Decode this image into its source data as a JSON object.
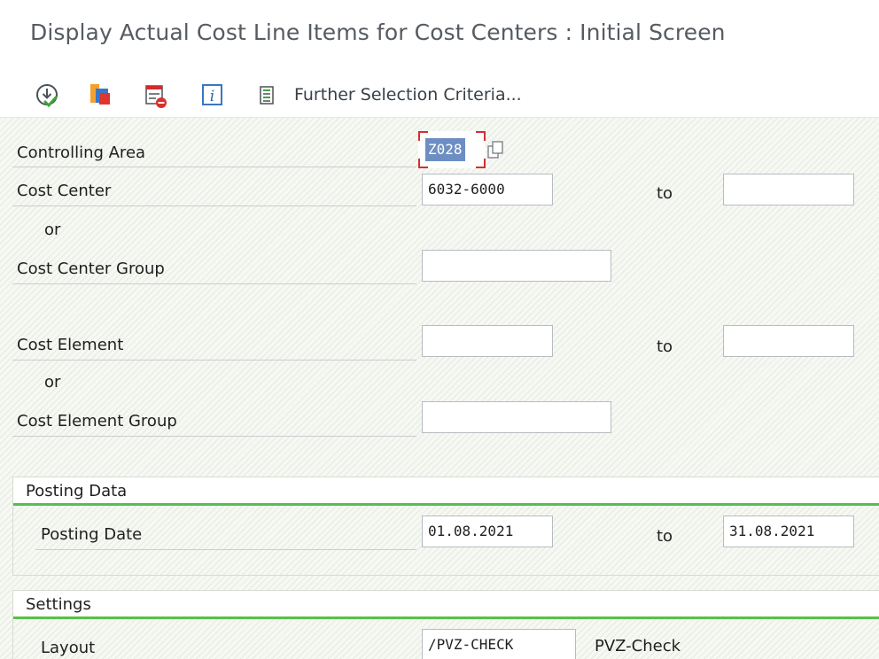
{
  "window": {
    "title": "Display Actual Cost Line Items for Cost Centers : Initial Screen"
  },
  "toolbar": {
    "execute_icon": "execute-icon",
    "variant_icon": "get-variant-icon",
    "delete_icon": "delete-selection-icon",
    "info_icon": "information-icon",
    "further_icon": "further-selection-icon",
    "further_label": "Further Selection Criteria..."
  },
  "form": {
    "controlling_area": {
      "label": "Controlling Area",
      "value": "Z028"
    },
    "cost_center": {
      "label": "Cost Center",
      "from_value": "6032-6000",
      "to_label": "to",
      "to_value": ""
    },
    "or_1": "or",
    "cost_center_group": {
      "label": "Cost Center Group",
      "value": ""
    },
    "cost_element": {
      "label": "Cost Element",
      "from_value": "",
      "to_label": "to",
      "to_value": ""
    },
    "or_2": "or",
    "cost_element_group": {
      "label": "Cost Element Group",
      "value": ""
    }
  },
  "posting_data": {
    "title": "Posting Data",
    "posting_date": {
      "label": "Posting Date",
      "from_value": "01.08.2021",
      "to_label": "to",
      "to_value": "31.08.2021"
    }
  },
  "settings": {
    "title": "Settings",
    "layout": {
      "label": "Layout",
      "value": "/PVZ-CHECK",
      "description": "PVZ-Check"
    }
  },
  "colors": {
    "group_underline": "#54c14a",
    "selection_highlight": "#6d8ec2",
    "focus_corner": "#d2302f"
  }
}
